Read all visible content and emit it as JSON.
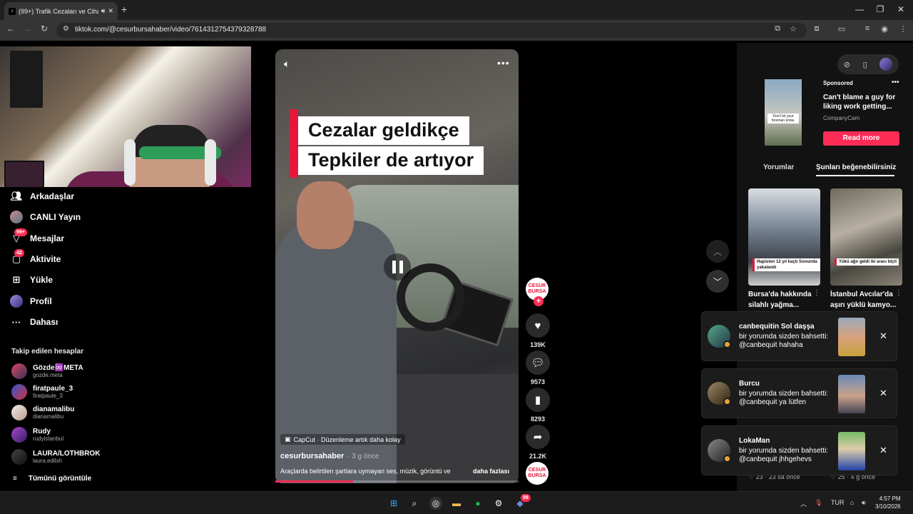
{
  "browser": {
    "tab_title": "(99+) Trafik Cezaları ve Ciha...",
    "url": "tiktok.com/@cesurbursahaber/video/7614312754379328788"
  },
  "sidebar": {
    "items": [
      {
        "label": "Arkadaşlar",
        "icon": "friends-icon"
      },
      {
        "label": "CANLI Yayın",
        "icon": "live-icon"
      },
      {
        "label": "Mesajlar",
        "icon": "messages-icon",
        "badge": "99+"
      },
      {
        "label": "Aktivite",
        "icon": "activity-icon",
        "badge": "42"
      },
      {
        "label": "Yükle",
        "icon": "upload-icon"
      },
      {
        "label": "Profil",
        "icon": "profile-icon"
      },
      {
        "label": "Dahası",
        "icon": "more-icon"
      }
    ],
    "following_title": "Takip edilen hesaplar",
    "following": [
      {
        "name": "Gözde♾️META",
        "handle": "gozde.meta"
      },
      {
        "name": "firatpaule_3",
        "handle": "firatpaule_3"
      },
      {
        "name": "dianamalibu",
        "handle": "dianamalibu"
      },
      {
        "name": "Rudy",
        "handle": "rudyistanbul"
      },
      {
        "name": "LAURA/LOTHBROK",
        "handle": "laura.edilsh"
      }
    ],
    "see_all": "Tümünü görüntüle"
  },
  "video": {
    "headline_line1": "Cezalar geldikçe",
    "headline_line2": "Tepkiler de artıyor",
    "capcut": "CapCut · Düzenleme artık daha kolay",
    "author": "cesurbursahaber",
    "time_ago": "· 3 g önce",
    "description": "Araçlarda belirtilen şartlara uymayan ses, müzik, görüntü ve",
    "more": "daha fazlası",
    "progress": 0.32,
    "logo_text": "CESUR BURSA"
  },
  "actions": {
    "likes": "139K",
    "comments": "9573",
    "saves": "8293",
    "shares": "21.2K"
  },
  "ad": {
    "sponsored": "Sponsored",
    "title": "Can't blame a guy for liking work getting...",
    "company": "CompanyCam",
    "button": "Read more",
    "image_caption": "Don't let your foreman know."
  },
  "right_tabs": {
    "comments": "Yorumlar",
    "recommended": "Şunları beğenebilirsiniz"
  },
  "recommended": [
    {
      "title": "Bursa'da hakkında silahlı yağma...",
      "caption": "Hapisten 12 yıl kaçtı Sonunda yakalandı",
      "likes": "♡ 23 · 23 sa önce"
    },
    {
      "title": "İstanbul Avcılar'da aşırı yüklü kamyo...",
      "caption": "Yükü ağır geldi iki aracı biçti",
      "likes": "♡ 25 · 4 g önce"
    }
  ],
  "notifications": [
    {
      "name": "canbequitin Sol daşşa",
      "line": "bir yorumda sizden bahsetti:",
      "text": "@canbequit hahaha"
    },
    {
      "name": "Burcu",
      "line": "bir yorumda sizden bahsetti:",
      "text": "@canbequit ya lütfen"
    },
    {
      "name": "LokaMan",
      "line": "bir yorumda sizden bahsetti:",
      "text": "@canbequit jhhgehevs"
    }
  ],
  "taskbar": {
    "lang": "TUR",
    "time": "4:57 PM",
    "date": "3/10/2026",
    "discord_badge": "99"
  }
}
